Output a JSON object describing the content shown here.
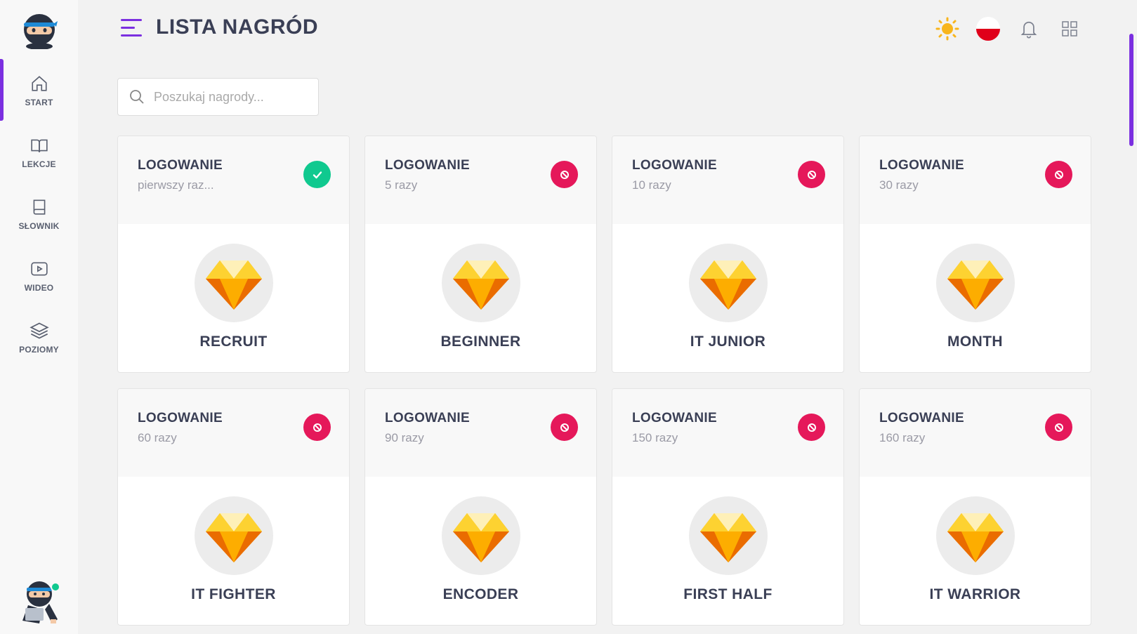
{
  "page": {
    "title": "LISTA NAGRÓD"
  },
  "sidebar": {
    "items": [
      {
        "label": "START",
        "icon": "home-icon",
        "active": true
      },
      {
        "label": "LEKCJE",
        "icon": "book-open-icon",
        "active": false
      },
      {
        "label": "SŁOWNIK",
        "icon": "book-icon",
        "active": false
      },
      {
        "label": "WIDEO",
        "icon": "video-icon",
        "active": false
      },
      {
        "label": "POZIOMY",
        "icon": "layers-icon",
        "active": false
      }
    ]
  },
  "header": {
    "icons": [
      "sun-icon",
      "flag-pl-icon",
      "bell-icon",
      "grid-icon"
    ]
  },
  "search": {
    "placeholder": "Poszukaj nagrody..."
  },
  "rewards": [
    {
      "category": "LOGOWANIE",
      "condition": "pierwszy raz...",
      "name": "RECRUIT",
      "status": "unlocked"
    },
    {
      "category": "LOGOWANIE",
      "condition": "5 razy",
      "name": "BEGINNER",
      "status": "locked"
    },
    {
      "category": "LOGOWANIE",
      "condition": "10 razy",
      "name": "IT JUNIOR",
      "status": "locked"
    },
    {
      "category": "LOGOWANIE",
      "condition": "30 razy",
      "name": "MONTH",
      "status": "locked"
    },
    {
      "category": "LOGOWANIE",
      "condition": "60 razy",
      "name": "IT FIGHTER",
      "status": "locked"
    },
    {
      "category": "LOGOWANIE",
      "condition": "90 razy",
      "name": "ENCODER",
      "status": "locked"
    },
    {
      "category": "LOGOWANIE",
      "condition": "150 razy",
      "name": "FIRST HALF",
      "status": "locked"
    },
    {
      "category": "LOGOWANIE",
      "condition": "160 razy",
      "name": "IT WARRIOR",
      "status": "locked"
    }
  ],
  "colors": {
    "accent": "#7b2fe0",
    "unlocked": "#10c98f",
    "locked": "#e5185a",
    "text": "#3a3f55"
  }
}
